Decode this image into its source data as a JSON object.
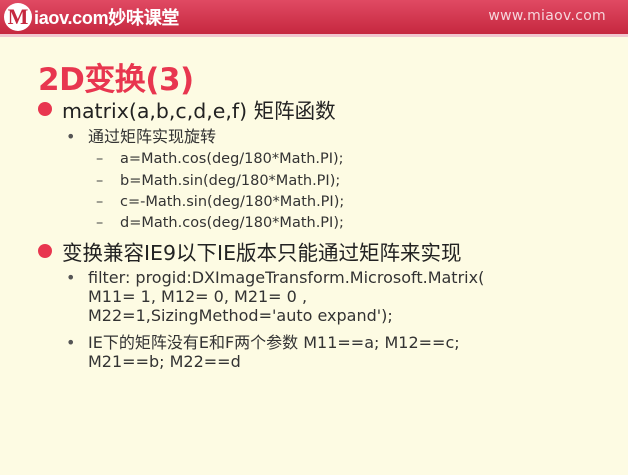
{
  "header": {
    "logo_letter": "M",
    "logo_text": "iaov.com妙味课堂",
    "site_url": "www.miaov.com"
  },
  "slide": {
    "title": "2D变换(3)",
    "sections": [
      {
        "heading": "matrix(a,b,c,d,e,f) 矩阵函数",
        "sub": "通过矩阵实现旋转",
        "items": [
          "a=Math.cos(deg/180*Math.PI);",
          "b=Math.sin(deg/180*Math.PI);",
          "c=-Math.sin(deg/180*Math.PI);",
          "d=Math.cos(deg/180*Math.PI);"
        ]
      },
      {
        "heading": "变换兼容IE9以下IE版本只能通过矩阵来实现",
        "sub1_lines": [
          "filter: progid:DXImageTransform.Microsoft.Matrix(",
          "M11= 1, M12= 0, M21= 0 ,",
          "M22=1,SizingMethod='auto expand');"
        ],
        "sub2_lines": [
          "IE下的矩阵没有E和F两个参数 M11==a; M12==c;",
          "M21==b; M22==d"
        ]
      }
    ],
    "bullet_color": "#e8364f",
    "header_color": "#d0324a",
    "background_color": "#fdfbe3"
  }
}
